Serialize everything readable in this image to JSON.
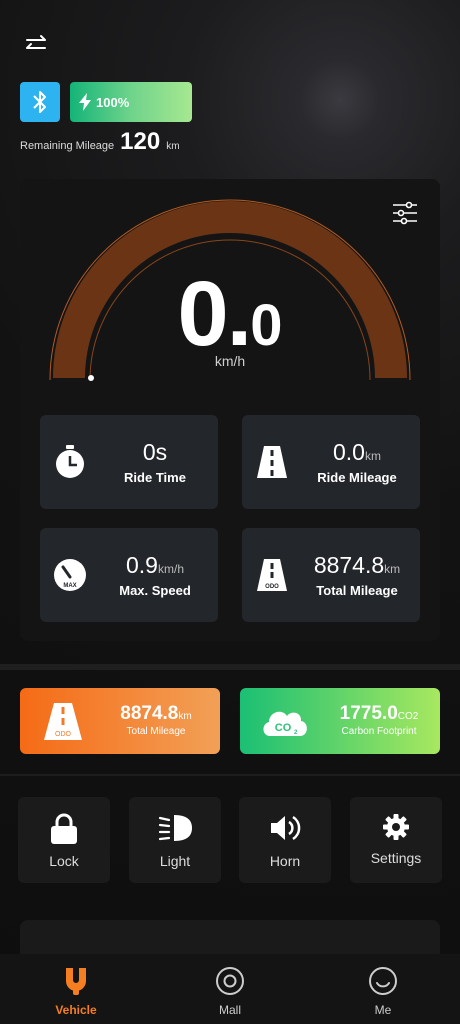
{
  "header": {
    "swap_icon": "swap-arrows-icon",
    "bluetooth_icon": "bluetooth-icon",
    "battery": {
      "value": "100%",
      "icon": "bolt-icon"
    },
    "remaining": {
      "label": "Remaining Mileage",
      "value": "120",
      "unit": "km"
    }
  },
  "speedometer": {
    "integer": "0.",
    "decimal": "0",
    "unit": "km/h",
    "settings_icon": "sliders-icon"
  },
  "stats": [
    {
      "value": "0s",
      "unit": "",
      "label": "Ride Time",
      "icon": "stopwatch-icon"
    },
    {
      "value": "0.0",
      "unit": "km",
      "label": "Ride Mileage",
      "icon": "road-icon"
    },
    {
      "value": "0.9",
      "unit": "km/h",
      "label": "Max. Speed",
      "icon": "speedometer-max-icon"
    },
    {
      "value": "8874.8",
      "unit": "km",
      "label": "Total Mileage",
      "icon": "road-odo-icon"
    }
  ],
  "summary": [
    {
      "value": "8874.8",
      "unit": "km",
      "label": "Total Mileage",
      "icon": "road-odo-icon",
      "gradient": [
        "#f56b16",
        "#f2a057"
      ]
    },
    {
      "value": "1775.0",
      "unit": "CO2",
      "label": "Carbon Footprint",
      "icon": "co2-cloud-icon",
      "gradient": [
        "#1bbf74",
        "#a8e85f"
      ]
    }
  ],
  "controls": [
    {
      "label": "Lock",
      "icon": "lock-icon"
    },
    {
      "label": "Light",
      "icon": "headlight-icon"
    },
    {
      "label": "Horn",
      "icon": "horn-icon"
    },
    {
      "label": "Settings",
      "icon": "gear-icon"
    }
  ],
  "tabs": [
    {
      "label": "Vehicle",
      "icon": "scooter-icon",
      "active": true
    },
    {
      "label": "Mall",
      "icon": "mall-icon",
      "active": false
    },
    {
      "label": "Me",
      "icon": "smiley-icon",
      "active": false
    }
  ],
  "colors": {
    "accent": "#f57f20",
    "gauge_arc": "#6b3515",
    "bluetooth": "#2db3f0"
  }
}
